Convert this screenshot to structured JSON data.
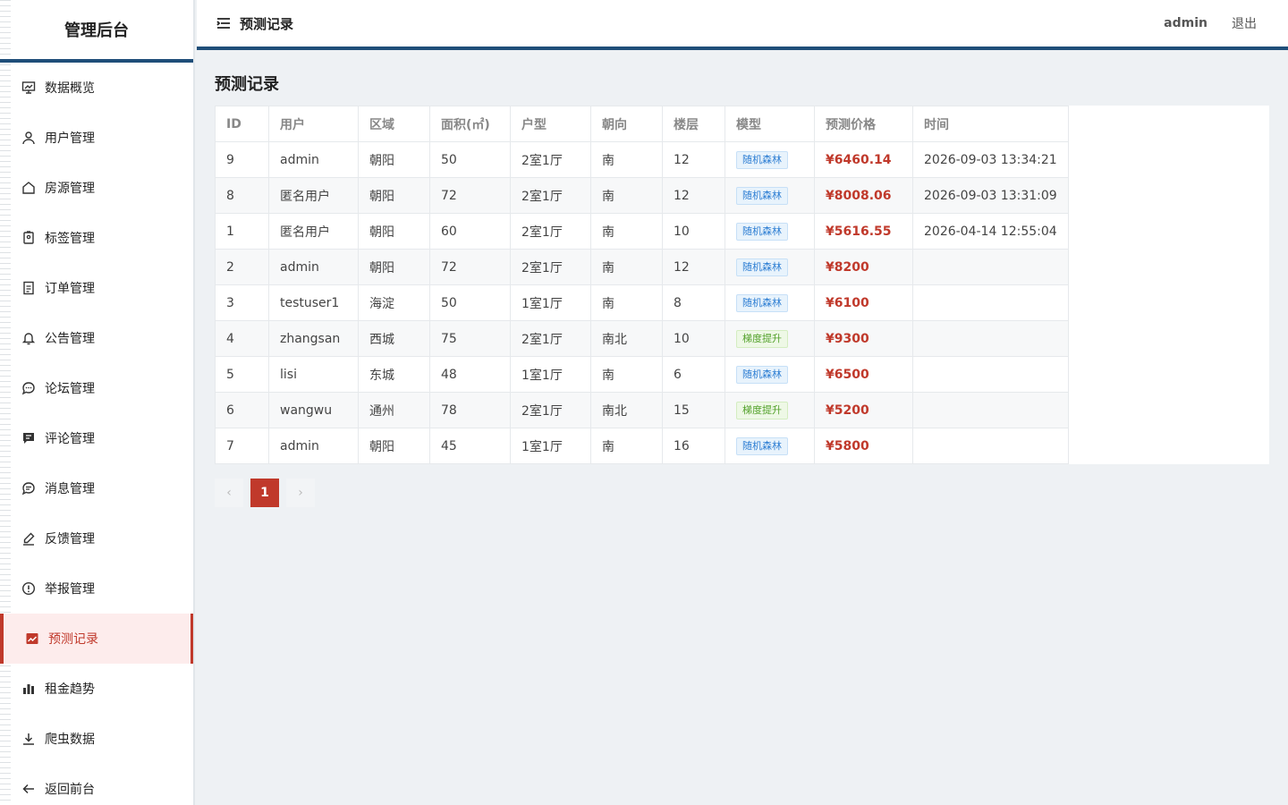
{
  "sidebar": {
    "brand": "管理后台",
    "items": [
      {
        "label": "数据概览",
        "icon": "dashboard-icon"
      },
      {
        "label": "用户管理",
        "icon": "user-icon"
      },
      {
        "label": "房源管理",
        "icon": "home-icon"
      },
      {
        "label": "标签管理",
        "icon": "tag-icon"
      },
      {
        "label": "订单管理",
        "icon": "document-icon"
      },
      {
        "label": "公告管理",
        "icon": "bell-icon"
      },
      {
        "label": "论坛管理",
        "icon": "chat-icon"
      },
      {
        "label": "评论管理",
        "icon": "comment-icon"
      },
      {
        "label": "消息管理",
        "icon": "message-icon"
      },
      {
        "label": "反馈管理",
        "icon": "edit-icon"
      },
      {
        "label": "举报管理",
        "icon": "alert-icon"
      },
      {
        "label": "预测记录",
        "icon": "trend-icon",
        "active": true
      },
      {
        "label": "租金趋势",
        "icon": "bar-chart-icon"
      },
      {
        "label": "爬虫数据",
        "icon": "download-icon"
      },
      {
        "label": "返回前台",
        "icon": "arrow-left-icon"
      }
    ]
  },
  "topbar": {
    "title": "预测记录",
    "user": "admin",
    "logout": "退出"
  },
  "main": {
    "title": "预测记录",
    "columns": [
      "ID",
      "用户",
      "区域",
      "面积(㎡)",
      "户型",
      "朝向",
      "楼层",
      "模型",
      "预测价格",
      "时间"
    ],
    "rows": [
      {
        "id": "9",
        "user": "admin",
        "area": "朝阳",
        "size": "50",
        "layout": "2室1厅",
        "facing": "南",
        "floor": "12",
        "model": "随机森林",
        "model_color": "blue",
        "price": "¥6460.14",
        "time": "2026-09-03 13:34:21"
      },
      {
        "id": "8",
        "user": "匿名用户",
        "area": "朝阳",
        "size": "72",
        "layout": "2室1厅",
        "facing": "南",
        "floor": "12",
        "model": "随机森林",
        "model_color": "blue",
        "price": "¥8008.06",
        "time": "2026-09-03 13:31:09"
      },
      {
        "id": "1",
        "user": "匿名用户",
        "area": "朝阳",
        "size": "60",
        "layout": "2室1厅",
        "facing": "南",
        "floor": "10",
        "model": "随机森林",
        "model_color": "blue",
        "price": "¥5616.55",
        "time": "2026-04-14 12:55:04"
      },
      {
        "id": "2",
        "user": "admin",
        "area": "朝阳",
        "size": "72",
        "layout": "2室1厅",
        "facing": "南",
        "floor": "12",
        "model": "随机森林",
        "model_color": "blue",
        "price": "¥8200",
        "time": ""
      },
      {
        "id": "3",
        "user": "testuser1",
        "area": "海淀",
        "size": "50",
        "layout": "1室1厅",
        "facing": "南",
        "floor": "8",
        "model": "随机森林",
        "model_color": "blue",
        "price": "¥6100",
        "time": ""
      },
      {
        "id": "4",
        "user": "zhangsan",
        "area": "西城",
        "size": "75",
        "layout": "2室1厅",
        "facing": "南北",
        "floor": "10",
        "model": "梯度提升",
        "model_color": "green",
        "price": "¥9300",
        "time": ""
      },
      {
        "id": "5",
        "user": "lisi",
        "area": "东城",
        "size": "48",
        "layout": "1室1厅",
        "facing": "南",
        "floor": "6",
        "model": "随机森林",
        "model_color": "blue",
        "price": "¥6500",
        "time": ""
      },
      {
        "id": "6",
        "user": "wangwu",
        "area": "通州",
        "size": "78",
        "layout": "2室1厅",
        "facing": "南北",
        "floor": "15",
        "model": "梯度提升",
        "model_color": "green",
        "price": "¥5200",
        "time": ""
      },
      {
        "id": "7",
        "user": "admin",
        "area": "朝阳",
        "size": "45",
        "layout": "1室1厅",
        "facing": "南",
        "floor": "16",
        "model": "随机森林",
        "model_color": "blue",
        "price": "¥5800",
        "time": ""
      }
    ]
  },
  "pagination": {
    "prev": "‹",
    "current": "1",
    "next": "›"
  },
  "colors": {
    "accent": "#c0392b",
    "brand_bar": "#1f4e79"
  }
}
